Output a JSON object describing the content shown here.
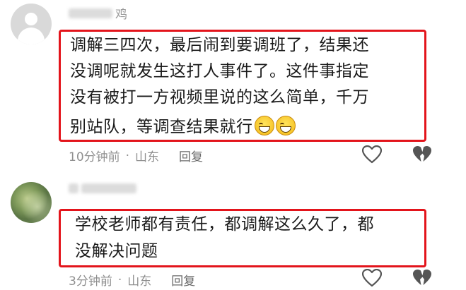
{
  "comments": [
    {
      "username": "鸡",
      "lines": [
        "调解三四次，最后闹到要调班了，结果还",
        "没调呢就发生这打人事件了。这件事指定",
        "没有被打一方视频里说的这么简单，千万",
        "别站队，等调查结果就行"
      ],
      "emoji": [
        "grinning-face-icon",
        "grinning-face-icon"
      ],
      "time": "10分钟前",
      "separator": "·",
      "location": "山东",
      "reply_label": "回复"
    },
    {
      "username": "",
      "lines": [
        "学校老师都有责任，都调解这么久了，都",
        "没解决问题"
      ],
      "time": "3分钟前",
      "separator": "·",
      "location": "山东",
      "reply_label": "回复"
    }
  ],
  "icons": [
    "like-heart-icon",
    "dislike-broken-heart-icon"
  ],
  "colors": {
    "highlight": "#e3141b",
    "meta": "#8f8f8f",
    "text": "#1a1a1a"
  }
}
